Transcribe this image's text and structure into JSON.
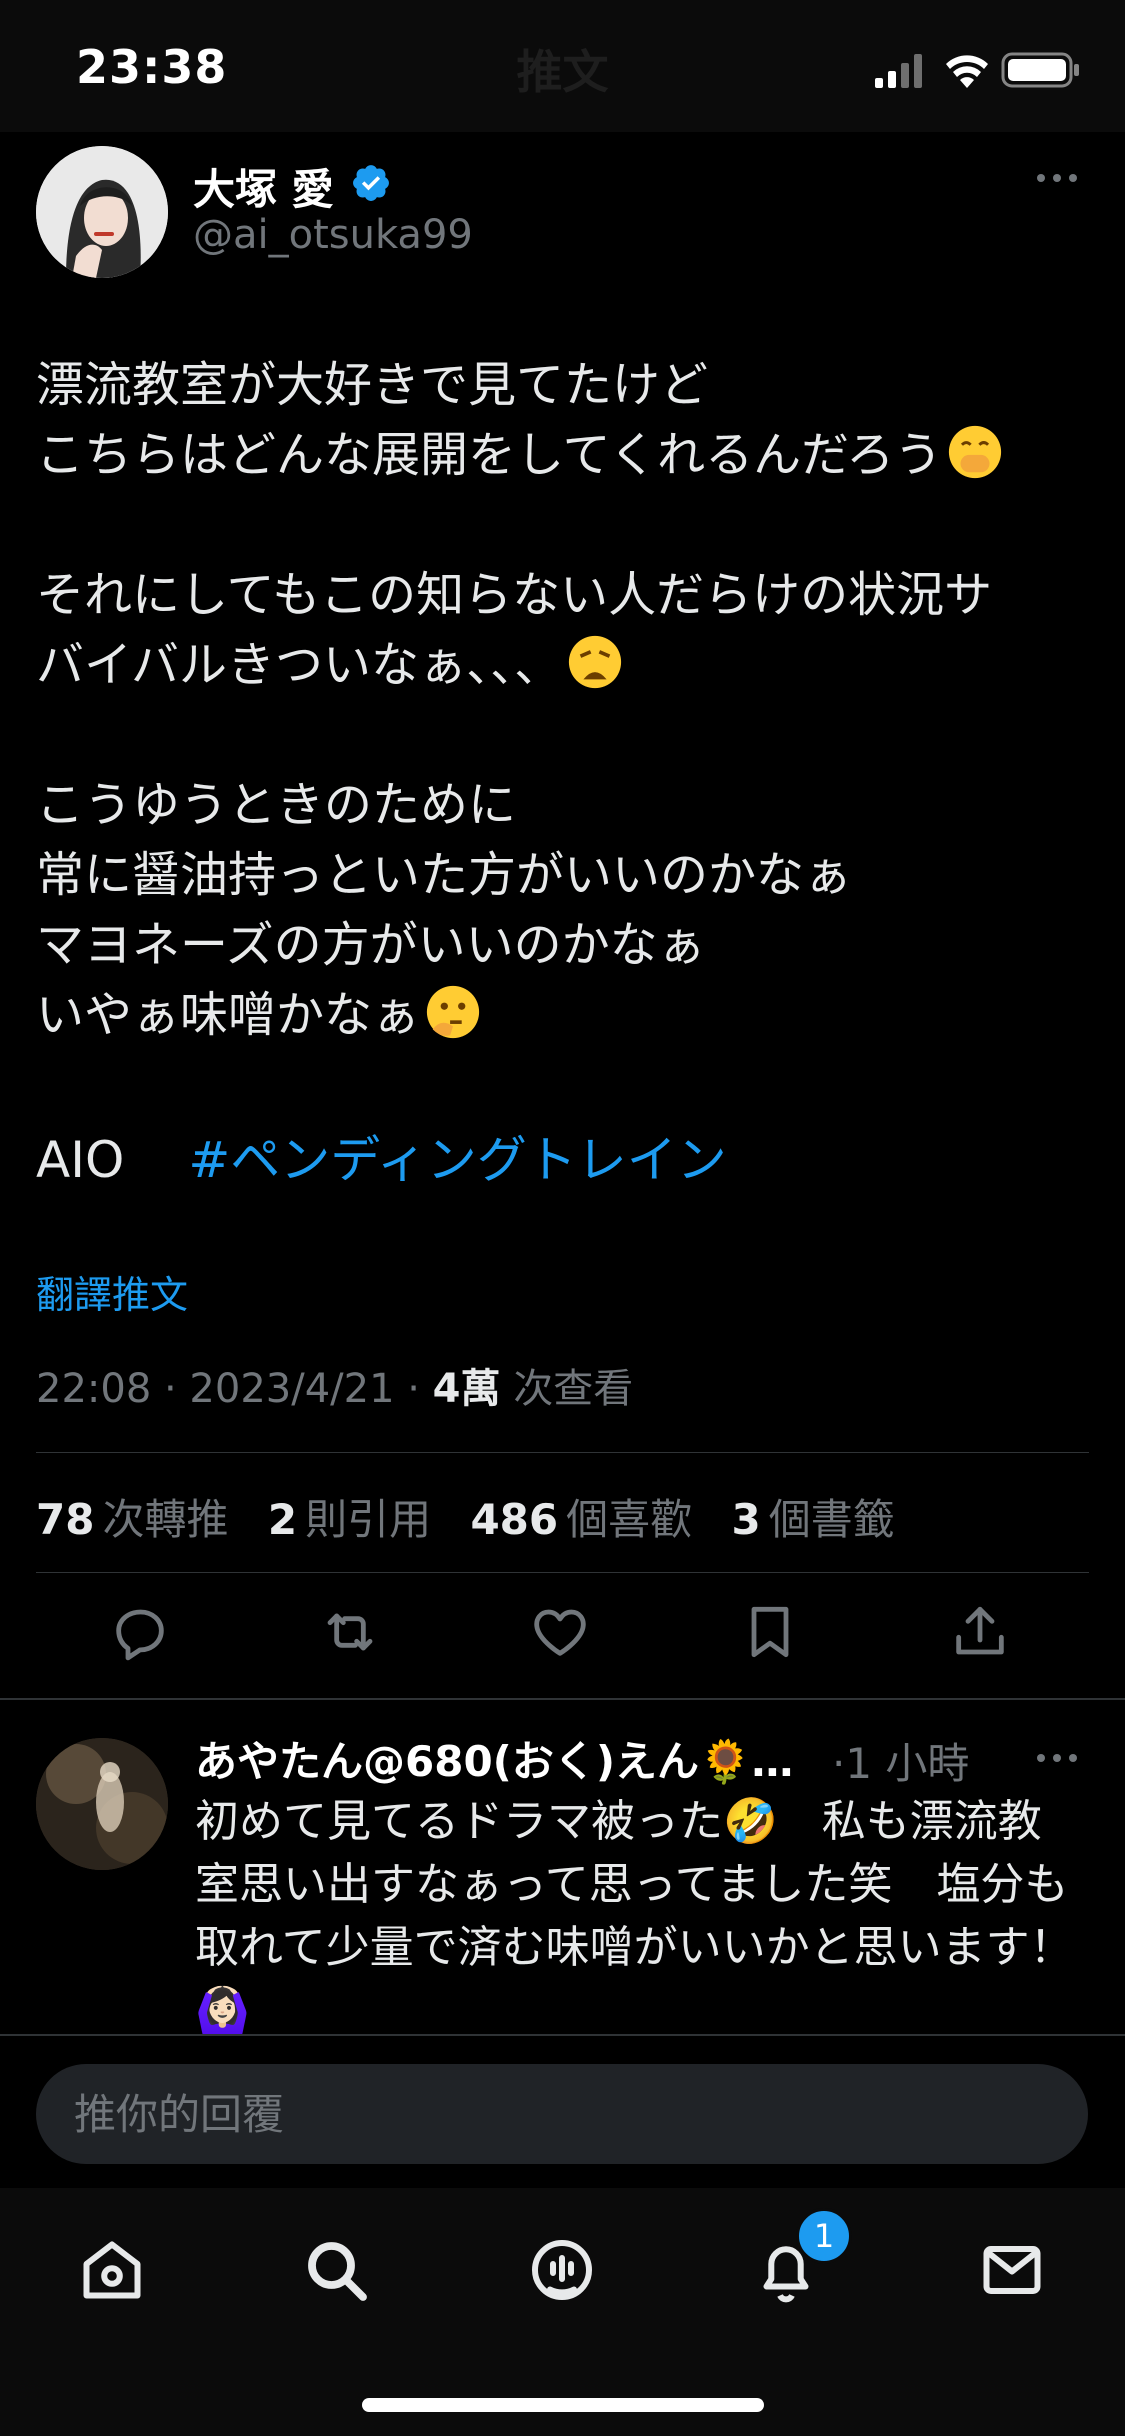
{
  "status_bar": {
    "time": "23:38",
    "ghost_title": "推文"
  },
  "tweet": {
    "author_name": "大塚 愛",
    "author_handle": "@ai_otsuka99",
    "lines": [
      "漂流教室が大好きで見てたけど",
      "こちらはどんな展開をしてくれるんだろう",
      "",
      "それにしてもこの知らない人だらけの状況サ",
      "バイバルきついなぁ、、、",
      "",
      "こうゆうときのために",
      "常に醤油持っといた方がいいのかなぁ",
      "マヨネーズの方がいいのかなぁ",
      "いやぁ味噌かなぁ"
    ],
    "tag_prefix": "AIO",
    "hashtag": "#ペンディングトレイン",
    "translate_label": "翻譯推文",
    "time": "22:08 · 2023/4/21 · ",
    "views_count": "4萬",
    "views_label": " 次查看",
    "stats": {
      "retweets_count": "78",
      "retweets_label": "次轉推",
      "quotes_count": "2",
      "quotes_label": "則引用",
      "likes_count": "486",
      "likes_label": "個喜歡",
      "bookmarks_count": "3",
      "bookmarks_label": "個書籤"
    }
  },
  "reply": {
    "author_name": "あやたん@680(おく)えん🌻…",
    "time": "·1 小時",
    "text": "初めて見てるドラマ被った🤣　私も漂流教室思い出すなぁって思ってました笑　塩分も取れて少量で済む味噌がいいかと思います！🙆🏻‍♀️"
  },
  "composer": {
    "placeholder": "推你的回覆"
  },
  "tabbar": {
    "notifications_badge": "1"
  },
  "colors": {
    "accent": "#1d9bf0",
    "muted": "#71767b",
    "text": "#e7e9ea",
    "background": "#000000"
  }
}
